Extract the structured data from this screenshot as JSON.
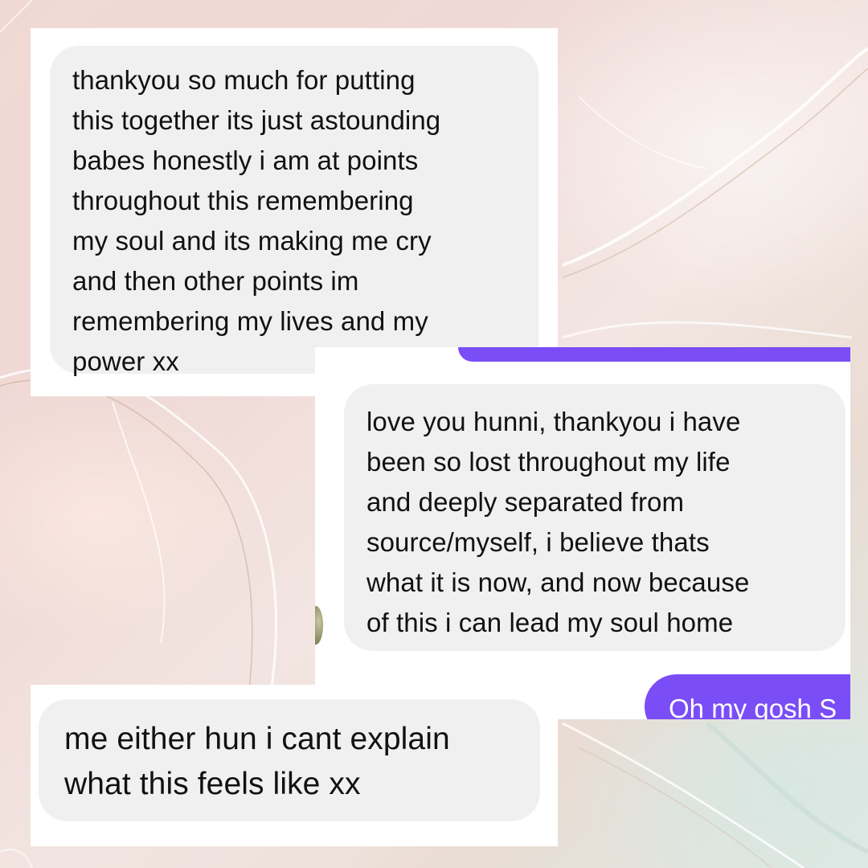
{
  "conversation": {
    "message_1": "thankyou so much for putting\nthis together its just astounding\nbabes honestly i am at points\nthroughout this remembering\nmy soul and its making me cry\nand then other points im\nremembering my lives and my\npower xx",
    "message_2": "love you hunni, thankyou i have\nbeen so lost throughout my life\nand deeply separated from\nsource/myself, i believe thats\nwhat it is now, and now because\nof this i can lead my soul home",
    "sent_message_partial": "Oh my gosh S",
    "message_3": "me either hun i cant explain\nwhat this feels like xx"
  },
  "colors": {
    "received_bubble": "#f0f0f0",
    "sent_bubble": "#7a4df7",
    "card_background": "#ffffff"
  }
}
